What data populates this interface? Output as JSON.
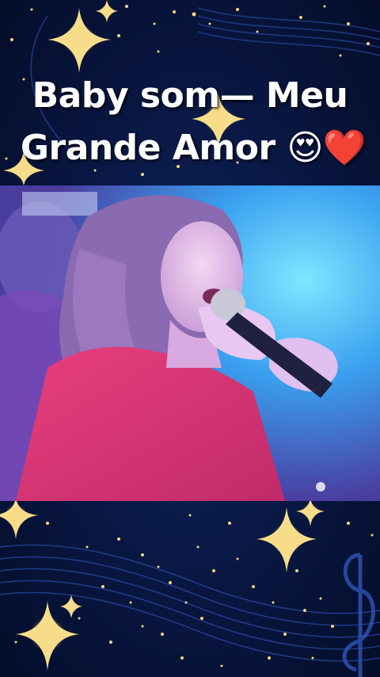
{
  "title": {
    "line1": "Baby som— Meu",
    "line2": "Grande Amor 😍❤️"
  },
  "icons": [
    "sparkle-star-icon",
    "music-staff-icon",
    "treble-clef-icon"
  ],
  "colors": {
    "background": "#0a1a4a",
    "stars": "#f5d77a",
    "title_text": "#ffffff",
    "stage_light": "#2fc0f0",
    "dress": "#e0306a"
  }
}
